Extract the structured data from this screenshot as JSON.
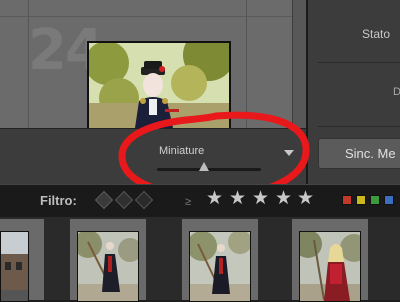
{
  "grid": {
    "cell_number": "24"
  },
  "right_panel": {
    "stato_label": "Stato",
    "partial_label": "D",
    "sync_button": "Sinc. Me"
  },
  "toolbar": {
    "thumbnail_slider_label": "Miniature",
    "thumbnail_size_fraction": 0.45
  },
  "filter_bar": {
    "label": "Filtro:",
    "rating_operator": "≥",
    "stars": [
      "★",
      "★",
      "★",
      "★",
      "★"
    ],
    "color_labels": [
      "#c0392b",
      "#c9b81e",
      "#3e9a3e",
      "#3a6fbf",
      "#8e44ad"
    ]
  },
  "icons": [
    "flag-icon",
    "dropdown-arrow-icon",
    "star-icon"
  ],
  "annotation": {
    "color": "#e8181b"
  }
}
